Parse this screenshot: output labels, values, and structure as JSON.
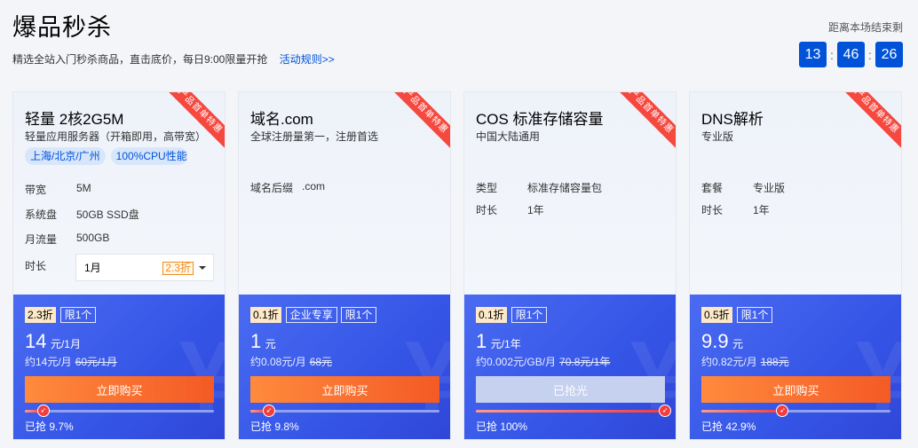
{
  "header": {
    "title": "爆品秒杀",
    "subtitle": "精选全站入门秒杀商品，直击底价，每日9:00限量开抢",
    "rules_link": "活动规则>>",
    "countdown_label": "距离本场结束剩",
    "countdown": {
      "h": "13",
      "m": "46",
      "s": "26",
      "sep": ":"
    }
  },
  "colors": {
    "brand": "#0052d9",
    "ribbon": "#f5483e",
    "buy": "#f45a25",
    "panel": "#3555e7"
  },
  "cards": [
    {
      "ribbon": "产品首单特惠",
      "name": "轻量 2核2G5M",
      "desc": "轻量应用服务器（开箱即用，高带宽）",
      "tags": [
        "上海/北京/广州",
        "100%CPU性能"
      ],
      "specs": [
        {
          "label": "带宽",
          "value": "5M"
        },
        {
          "label": "系统盘",
          "value": "50GB SSD盘"
        },
        {
          "label": "月流量",
          "value": "500GB"
        }
      ],
      "duration_label": "时长",
      "duration_value": "1月",
      "duration_badge": "2.3折",
      "discount": "2.3折",
      "badges": [
        "限1个"
      ],
      "price": "14",
      "price_unit": "元/1月",
      "price_ref": "约14元/月",
      "original_price": "60元/1月",
      "button": "立即购买",
      "button_disabled": false,
      "progress": 0.097,
      "sold_text": "已抢 9.7%"
    },
    {
      "ribbon": "产品首单特惠",
      "name": "域名.com",
      "desc": "全球注册量第一，注册首选",
      "specs": [
        {
          "label": "域名后缀",
          "value": ".com"
        }
      ],
      "discount": "0.1折",
      "badges": [
        "企业专享",
        "限1个"
      ],
      "price": "1",
      "price_unit": "元",
      "price_ref": "约0.08元/月",
      "original_price": "68元",
      "button": "立即购买",
      "button_disabled": false,
      "progress": 0.098,
      "sold_text": "已抢 9.8%"
    },
    {
      "ribbon": "产品首单特惠",
      "name": "COS 标准存储容量",
      "desc": "中国大陆通用",
      "specs": [
        {
          "label": "类型",
          "value": "标准存储容量包"
        },
        {
          "label": "时长",
          "value": "1年"
        }
      ],
      "discount": "0.1折",
      "badges": [
        "限1个"
      ],
      "price": "1",
      "price_unit": "元/1年",
      "price_ref": "约0.002元/GB/月",
      "original_price": "70.8元/1年",
      "button": "已抢光",
      "button_disabled": true,
      "progress": 1.0,
      "sold_text": "已抢 100%"
    },
    {
      "ribbon": "产品首单特惠",
      "name": "DNS解析",
      "desc": "专业版",
      "specs": [
        {
          "label": "套餐",
          "value": "专业版"
        },
        {
          "label": "时长",
          "value": "1年"
        }
      ],
      "discount": "0.5折",
      "badges": [
        "限1个"
      ],
      "price": "9.9",
      "price_unit": "元",
      "price_ref": "约0.82元/月",
      "original_price": "188元",
      "button": "立即购买",
      "button_disabled": false,
      "progress": 0.429,
      "sold_text": "已抢 42.9%"
    }
  ]
}
